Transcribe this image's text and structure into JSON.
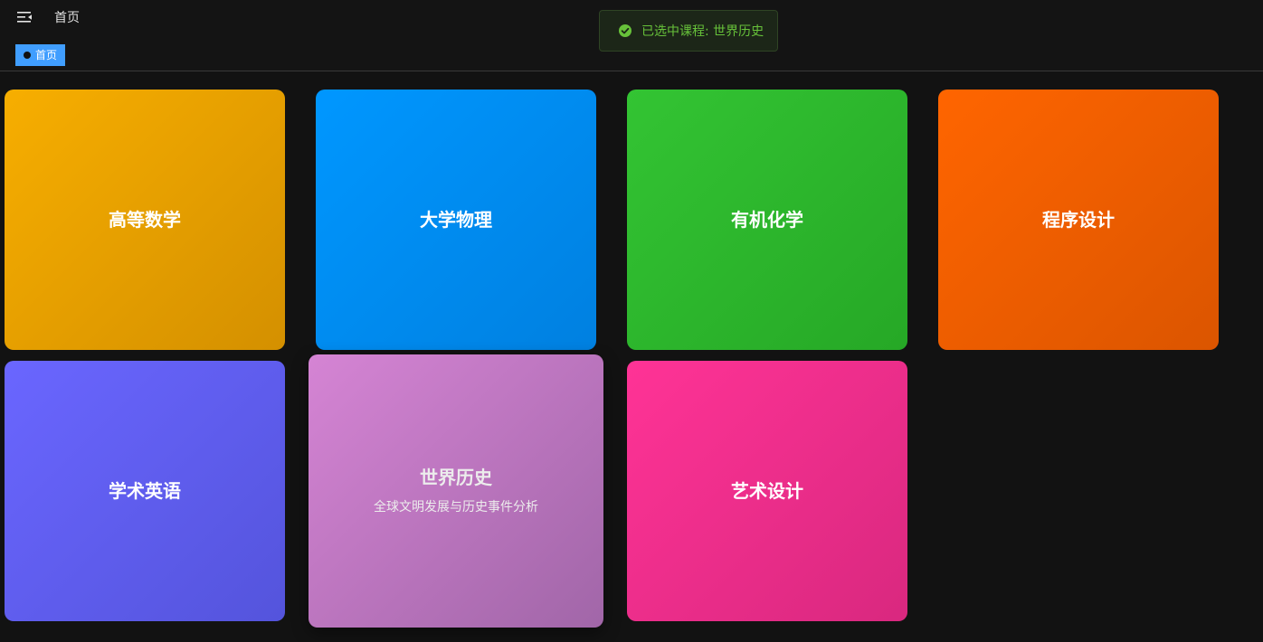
{
  "header": {
    "menu_icon": "menu-fold-icon",
    "breadcrumb": "首页"
  },
  "tags": [
    {
      "label": "首页",
      "active": true
    }
  ],
  "toast": {
    "icon": "check-circle-icon",
    "message": "已选中课程: 世界历史",
    "color": "#67c23a"
  },
  "courses": [
    {
      "title": "高等数学",
      "description": "",
      "color": "#f7ae00"
    },
    {
      "title": "大学物理",
      "description": "",
      "color": "#0097ff"
    },
    {
      "title": "有机化学",
      "description": "",
      "color": "#33c433"
    },
    {
      "title": "程序设计",
      "description": "",
      "color": "#ff6500"
    },
    {
      "title": "学术英语",
      "description": "",
      "color": "#6a66ff"
    },
    {
      "title": "世界历史",
      "description": "全球文明发展与历史事件分析",
      "color": "#d584d4",
      "hovered": true
    },
    {
      "title": "艺术设计",
      "description": "",
      "color": "#ff3396"
    }
  ]
}
